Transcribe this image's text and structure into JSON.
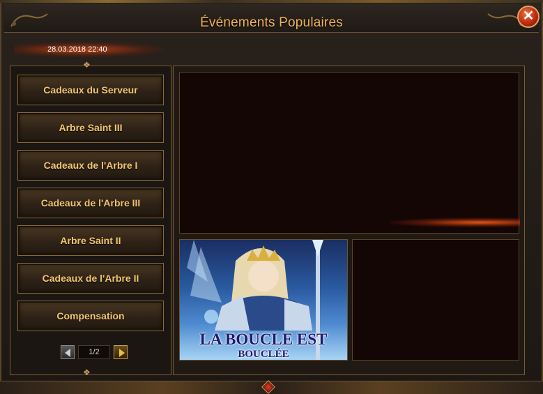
{
  "window": {
    "title": "Événements Populaires",
    "close_icon": "close-x-icon"
  },
  "date": "28.03.2018 22:40",
  "events": [
    {
      "label": "Cadeaux du Serveur"
    },
    {
      "label": "Arbre Saint III"
    },
    {
      "label": "Cadeaux de l'Arbre I"
    },
    {
      "label": "Cadeaux de l'Arbre III"
    },
    {
      "label": "Arbre Saint II"
    },
    {
      "label": "Cadeaux de l'Arbre II"
    },
    {
      "label": "Compensation"
    }
  ],
  "pager": {
    "page": "1/2",
    "prev_icon": "arrow-left-icon",
    "next_icon": "arrow-right-icon"
  },
  "banner": {
    "title": "LA BOUCLE EST",
    "subtitle": "BOUCLÉE"
  },
  "colors": {
    "title": "#f0b45a",
    "button_text": "#f3c770",
    "frame_border": "#7a5c30",
    "content_bg": "#140605",
    "glow": "#e85a19",
    "close_button": "#c02a10"
  }
}
